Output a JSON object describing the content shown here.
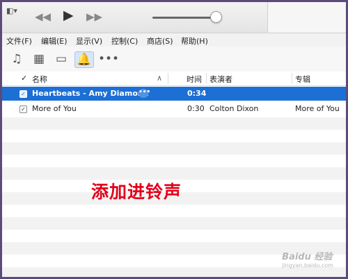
{
  "menu": [
    "文件(F)",
    "编辑(E)",
    "显示(V)",
    "控制(C)",
    "商店(S)",
    "帮助(H)"
  ],
  "media_icons": [
    "music-note-icon",
    "film-icon",
    "tv-icon",
    "bell-icon",
    "more-icon"
  ],
  "columns": {
    "check": "✓",
    "name": "名称",
    "sort": "∧",
    "time": "时间",
    "artist": "表演者",
    "album": "专辑"
  },
  "rows": [
    {
      "name": "Heartbeats - Amy Diamond",
      "time": "0:34",
      "artist": "",
      "album": "",
      "selected": true
    },
    {
      "name": "More of You",
      "time": "0:30",
      "artist": "Colton Dixon",
      "album": "More of You",
      "selected": false
    }
  ],
  "row_more": "•••",
  "caption": "添加进铃声",
  "watermark": {
    "main": "Baidu 经验",
    "sub": "jingyan.baidu.com"
  },
  "colors": {
    "selection": "#1c6fd4",
    "caption": "#e4001a"
  }
}
